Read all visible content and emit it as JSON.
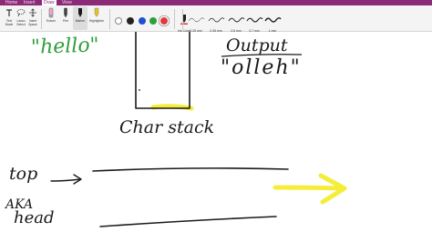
{
  "ribbon": {
    "tabs": [
      "Home",
      "Insert",
      "Draw",
      "View"
    ],
    "active_tab": "Draw",
    "tools": [
      {
        "label": "Text\nMode",
        "icon": "text-mode-icon"
      },
      {
        "label": "Lasso\nSelect",
        "icon": "lasso-select-icon"
      },
      {
        "label": "Insert\nSpace",
        "icon": "insert-space-icon"
      },
      {
        "label": "Eraser",
        "icon": "eraser-icon"
      },
      {
        "label": "Pen",
        "icon": "pen-icon"
      },
      {
        "label": "Marker",
        "icon": "marker-icon"
      },
      {
        "label": "Highlighter",
        "icon": "highlighter-icon"
      }
    ],
    "colors": [
      {
        "name": "white",
        "hex": "#ffffff"
      },
      {
        "name": "black",
        "hex": "#222222"
      },
      {
        "name": "blue",
        "hex": "#1f4fd6"
      },
      {
        "name": "green",
        "hex": "#2f9e3c"
      },
      {
        "name": "red",
        "hex": "#e23a3a"
      }
    ],
    "ink_color_label": "Ink Color",
    "stroke_sizes": [
      "0.25 mm",
      "0.35 mm",
      "0.5 mm",
      "0.7 mm",
      "1 mm"
    ]
  },
  "canvas": {
    "annotations": [
      {
        "text": "\"hello\"",
        "color": "#2f9e3c"
      },
      {
        "text": "Output",
        "color": "#1a1a1a"
      },
      {
        "text": "\"olleh\"",
        "color": "#1a1a1a"
      },
      {
        "text": "Char stack",
        "color": "#1a1a1a"
      },
      {
        "text": "top",
        "color": "#1a1a1a"
      },
      {
        "text": "AKA",
        "color": "#1a1a1a"
      },
      {
        "text": "head",
        "color": "#1a1a1a"
      }
    ],
    "highlight_color": "#f4ee3a"
  }
}
